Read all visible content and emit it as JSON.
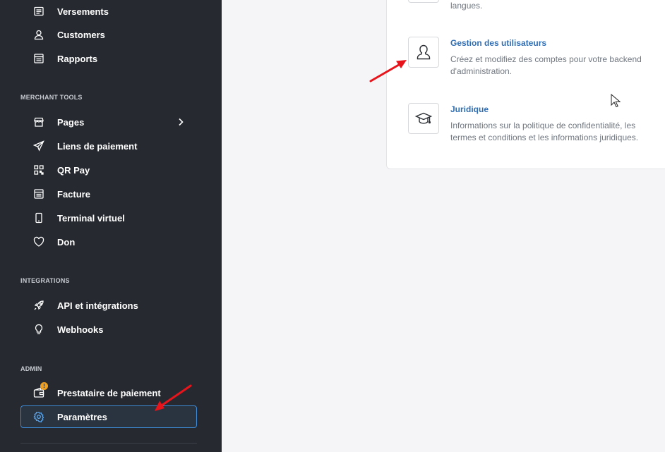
{
  "sidebar": {
    "top_items": [
      {
        "label": "Versements",
        "icon": "receipt-icon"
      },
      {
        "label": "Customers",
        "icon": "user-icon"
      },
      {
        "label": "Rapports",
        "icon": "report-icon"
      }
    ],
    "merchant_tools": {
      "title": "MERCHANT TOOLS",
      "items": [
        {
          "label": "Pages",
          "icon": "store-icon",
          "has_chevron": true
        },
        {
          "label": "Liens de paiement",
          "icon": "send-icon"
        },
        {
          "label": "QR Pay",
          "icon": "qr-icon"
        },
        {
          "label": "Facture",
          "icon": "invoice-icon"
        },
        {
          "label": "Terminal virtuel",
          "icon": "terminal-icon"
        },
        {
          "label": "Don",
          "icon": "heart-icon"
        }
      ]
    },
    "integrations": {
      "title": "INTEGRATIONS",
      "items": [
        {
          "label": "API et intégrations",
          "icon": "rocket-icon"
        },
        {
          "label": "Webhooks",
          "icon": "bulb-icon"
        }
      ]
    },
    "admin": {
      "title": "ADMIN",
      "items": [
        {
          "label": "Prestataire de paiement",
          "icon": "wallet-icon",
          "badge": "!"
        },
        {
          "label": "Paramètres",
          "icon": "gear-icon",
          "active": true
        }
      ]
    }
  },
  "settings": {
    "partial_desc": "langues.",
    "user_management": {
      "title": "Gestion des utilisateurs",
      "description": "Créez et modifiez des comptes pour votre backend d'administration."
    },
    "legal": {
      "title": "Juridique",
      "description": "Informations sur la politique de confidentialité, les termes et conditions et les informations juridiques."
    }
  },
  "colors": {
    "sidebar_bg": "#262a30",
    "active_border": "#3d8ad6",
    "link_blue": "#2f6eb5",
    "badge_orange": "#f0a020",
    "annotation_red": "#e8141b"
  }
}
